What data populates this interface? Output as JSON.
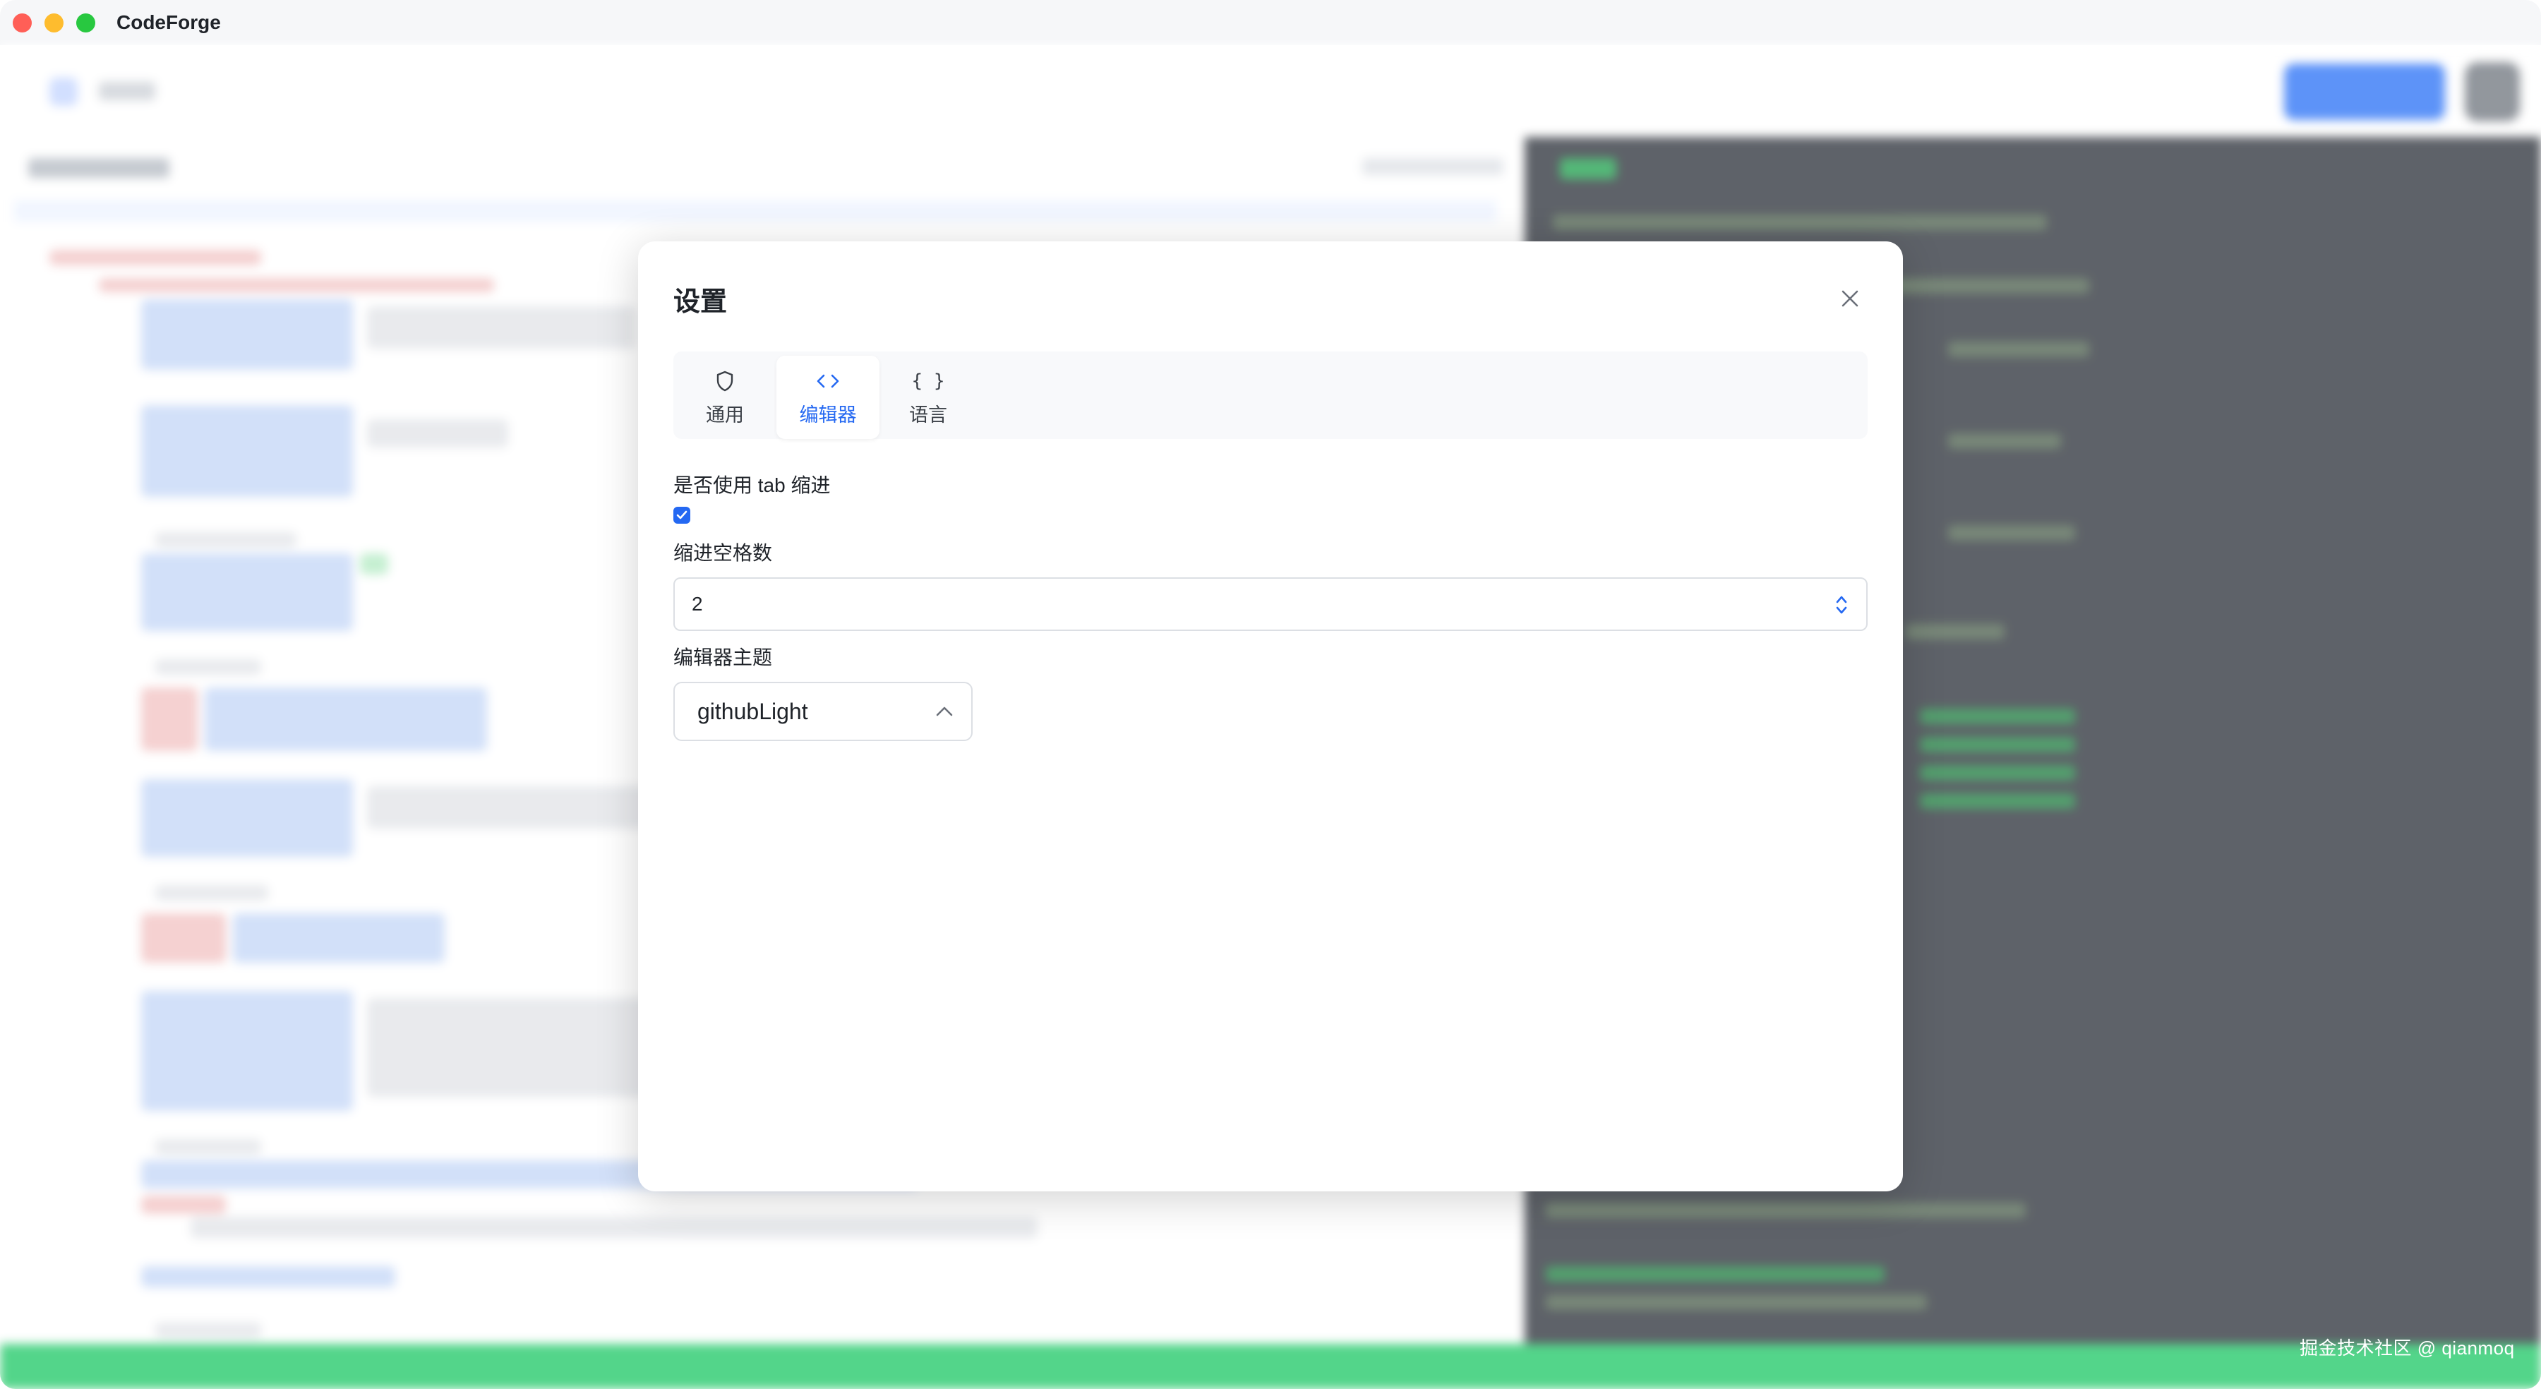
{
  "window": {
    "app_title": "CodeForge"
  },
  "settings_dialog": {
    "title": "设置",
    "tabs": [
      {
        "label": "通用",
        "icon": "shield-icon",
        "active": false
      },
      {
        "label": "编辑器",
        "icon": "code-icon",
        "active": true
      },
      {
        "label": "语言",
        "icon": "braces-icon",
        "active": false
      }
    ],
    "use_tab_indent": {
      "label": "是否使用 tab 缩进",
      "checked": true
    },
    "indent_spaces": {
      "label": "缩进空格数",
      "value": "2"
    },
    "editor_theme": {
      "label": "编辑器主题",
      "selected": "githubLight"
    }
  },
  "watermark": "掘金技术社区 @ qianmoq",
  "colors": {
    "accent": "#2468f2",
    "status_bar": "#2ecc71",
    "dark_panel": "#3b4048"
  }
}
